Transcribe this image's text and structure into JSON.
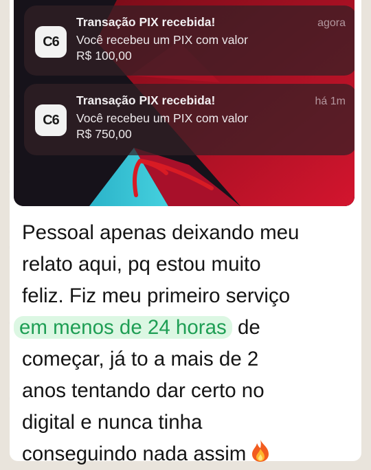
{
  "notifications": [
    {
      "app_icon_label": "C6",
      "title": "Transação PIX recebida!",
      "time": "agora",
      "body_line1": "Você recebeu um PIX com valor",
      "body_line2": "R$ 100,00"
    },
    {
      "app_icon_label": "C6",
      "title": "Transação PIX recebida!",
      "time": "há 1m",
      "body_line1": "Você recebeu um PIX com valor",
      "body_line2": "R$ 750,00"
    }
  ],
  "message": {
    "line1": "Pessoal apenas deixando meu",
    "line2": "relato aqui, pq estou muito",
    "line3": "feliz. Fiz meu primeiro serviço",
    "line4_highlight": "em menos de 24 horas",
    "line4_rest": "de",
    "line5": "começar, já to a mais de 2",
    "line6": "anos tentando dar certo no",
    "line7": "digital e nunca tinha",
    "line8": "conseguindo nada assim"
  },
  "icons": {
    "annotation": "red-arrow-icon",
    "emoji": "fire-emoji-icon"
  },
  "colors": {
    "highlight_text": "#1e9e54",
    "highlight_bg": "#dcf7e3",
    "wallpaper_red": "#c8142b",
    "wallpaper_cyan": "#35c2d6",
    "arrow": "#d81b24"
  }
}
